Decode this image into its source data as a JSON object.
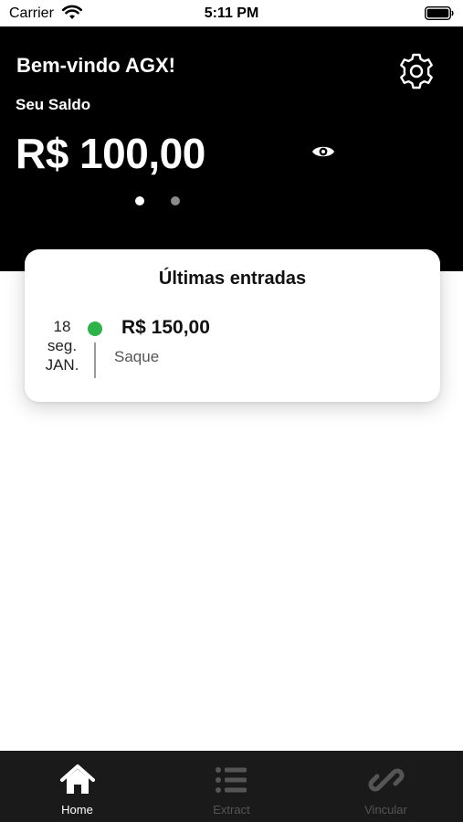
{
  "status_bar": {
    "carrier": "Carrier",
    "time": "5:11 PM"
  },
  "header": {
    "welcome": "Bem-vindo AGX!",
    "balance_label": "Seu Saldo",
    "balance_value": "R$ 100,00",
    "page_count": 2,
    "active_page": 1
  },
  "card": {
    "title": "Últimas entradas",
    "entries": [
      {
        "day": "18",
        "weekday": "seg.",
        "month": "JAN.",
        "amount": "R$ 150,00",
        "description": "Saque",
        "status_color": "#2db34a"
      }
    ]
  },
  "tabs": [
    {
      "label": "Home",
      "icon": "home-icon",
      "active": true
    },
    {
      "label": "Extract",
      "icon": "list-icon",
      "active": false
    },
    {
      "label": "Vincular",
      "icon": "link-icon",
      "active": false
    }
  ],
  "colors": {
    "header_bg": "#000000",
    "tab_bar_bg": "#1a1a1a",
    "accent_green": "#2db34a"
  }
}
